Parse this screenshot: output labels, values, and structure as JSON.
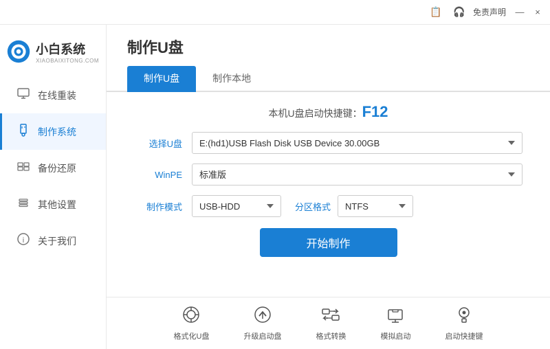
{
  "titlebar": {
    "icon1_label": "📋",
    "icon2_label": "🎧",
    "free_label": "免责声明",
    "min_label": "—",
    "close_label": "×"
  },
  "logo": {
    "main": "小白系统",
    "sub": "XIAOBAIXITONG.COM"
  },
  "sidebar": {
    "items": [
      {
        "id": "online-reinstall",
        "icon": "🖥",
        "label": "在线重装"
      },
      {
        "id": "make-system",
        "icon": "💾",
        "label": "制作系统"
      },
      {
        "id": "backup-restore",
        "icon": "📋",
        "label": "备份还原"
      },
      {
        "id": "other-settings",
        "icon": "🔒",
        "label": "其他设置"
      },
      {
        "id": "about-us",
        "icon": "ℹ",
        "label": "关于我们"
      }
    ]
  },
  "content": {
    "page_title": "制作U盘",
    "tabs": [
      {
        "id": "make-udisk",
        "label": "制作U盘",
        "active": true
      },
      {
        "id": "make-local",
        "label": "制作本地",
        "active": false
      }
    ],
    "shortcut_prefix": "本机U盘启动快捷键：",
    "shortcut_key": "F12",
    "form": {
      "udisk_label": "选择U盘",
      "udisk_value": "E:(hd1)USB Flash Disk USB Device 30.00GB",
      "winpe_label": "WinPE",
      "winpe_value": "标准版",
      "mode_label": "制作模式",
      "mode_value": "USB-HDD",
      "partition_label": "分区格式",
      "partition_value": "NTFS",
      "start_btn": "开始制作"
    },
    "bottom_tools": [
      {
        "id": "format-udisk",
        "icon": "⊙",
        "label": "格式化U盘"
      },
      {
        "id": "upgrade-boot",
        "icon": "⊕",
        "label": "升级启动盘"
      },
      {
        "id": "format-convert",
        "icon": "⇄",
        "label": "格式转换"
      },
      {
        "id": "simulate-boot",
        "icon": "⊞",
        "label": "模拟启动"
      },
      {
        "id": "shortcut-key",
        "icon": "🔑",
        "label": "启动快捷键"
      }
    ]
  }
}
